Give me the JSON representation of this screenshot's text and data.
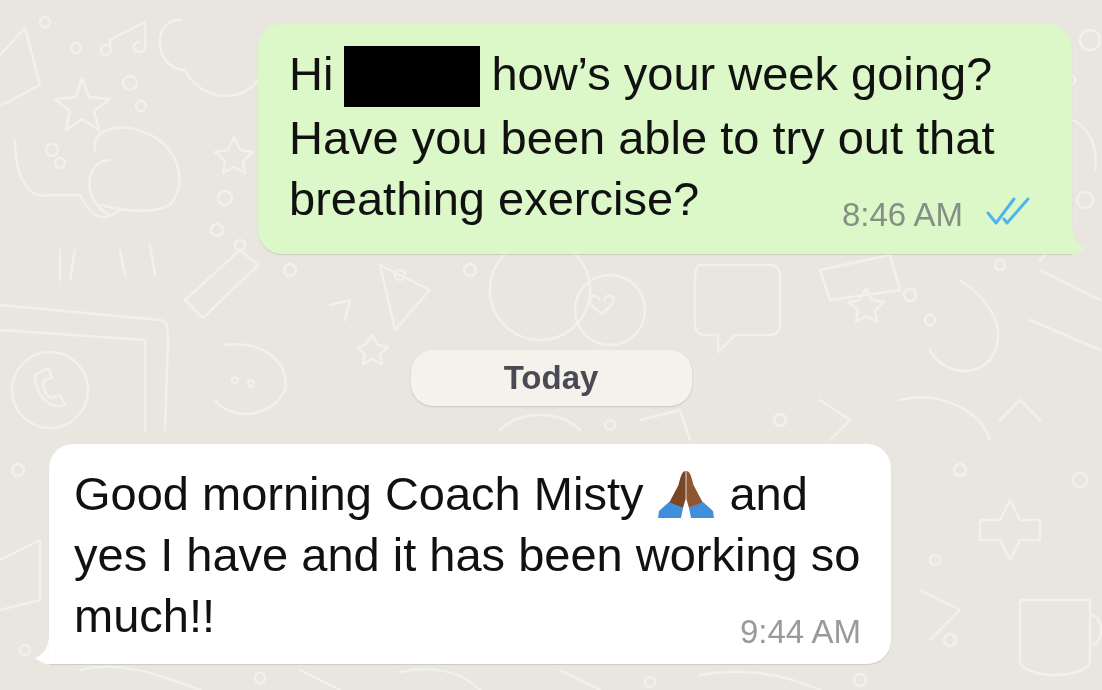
{
  "chat": {
    "messages": [
      {
        "kind": "outgoing",
        "lines": [
          [
            {
              "kind": "text",
              "text": "Hi"
            },
            {
              "kind": "redaction"
            },
            {
              "kind": "text",
              "text": "how’s your week going?"
            }
          ],
          [
            {
              "kind": "text",
              "text": "Have you been able to try out that"
            }
          ],
          [
            {
              "kind": "text",
              "text": "breathing exercise?"
            }
          ]
        ],
        "time": "8:46 AM",
        "read": true
      },
      {
        "kind": "date",
        "label": "Today"
      },
      {
        "kind": "incoming",
        "lines": [
          [
            {
              "kind": "text",
              "text": "Good morning Coach Misty"
            },
            {
              "kind": "emoji"
            },
            {
              "kind": "text",
              "text": "and"
            }
          ],
          [
            {
              "kind": "text",
              "text": "yes I have and it has been working so"
            }
          ],
          [
            {
              "kind": "text",
              "text": "much!!"
            }
          ]
        ],
        "time": "9:44 AM"
      }
    ]
  }
}
